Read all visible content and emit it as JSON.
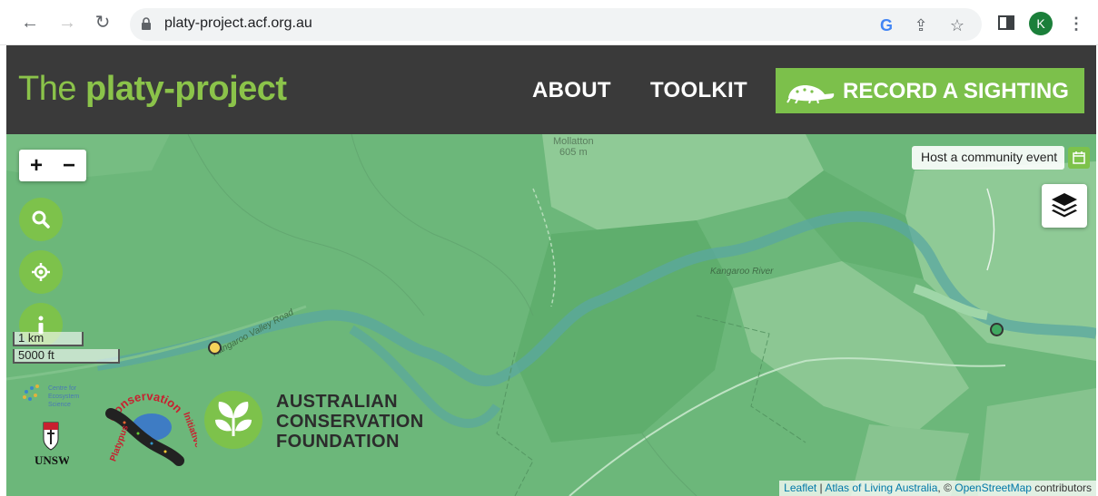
{
  "browser": {
    "url": "platy-project.acf.org.au",
    "profile_initial": "K",
    "icons": [
      "back-arrow-icon",
      "forward-arrow-icon",
      "reload-icon",
      "lock-icon",
      "google-icon",
      "share-icon",
      "bookmark-star-icon",
      "side-panel-icon",
      "more-menu-icon"
    ]
  },
  "header": {
    "brand_the": "The ",
    "brand_bold": "platy-project",
    "nav": [
      "ABOUT",
      "TOOLKIT"
    ],
    "cta_label": "RECORD A SIGHTING",
    "colors": {
      "bar": "#3a3a3a",
      "accent": "#7cc04b"
    }
  },
  "map": {
    "zoom_in": "+",
    "zoom_out": "−",
    "host_event_label": "Host a community event",
    "scale_km": "1 km",
    "scale_ft": "5000 ft",
    "peak_name": "Mollatton",
    "peak_elevation": "605 m",
    "river_label": "Kangaroo River",
    "road_label": "Kangaroo Valley Road",
    "markers": [
      {
        "color": "#f5d35a"
      },
      {
        "color": "#3fa860"
      }
    ],
    "buttons": [
      "search-icon",
      "locate-icon",
      "info-icon"
    ],
    "attribution": {
      "leaflet": "Leaflet",
      "sep1": " | ",
      "ala": "Atlas of Living Australia",
      "sep2": ", © ",
      "osm": "OpenStreetMap",
      "tail": " contributors"
    }
  },
  "logos": {
    "acf_line1": "AUSTRALIAN",
    "acf_line2": "CONSERVATION",
    "acf_line3": "FOUNDATION",
    "pci_text": "Platypus Conservation Initiative",
    "unsw_text": "UNSW",
    "ces_text": "Centre for Ecosystem Science"
  }
}
